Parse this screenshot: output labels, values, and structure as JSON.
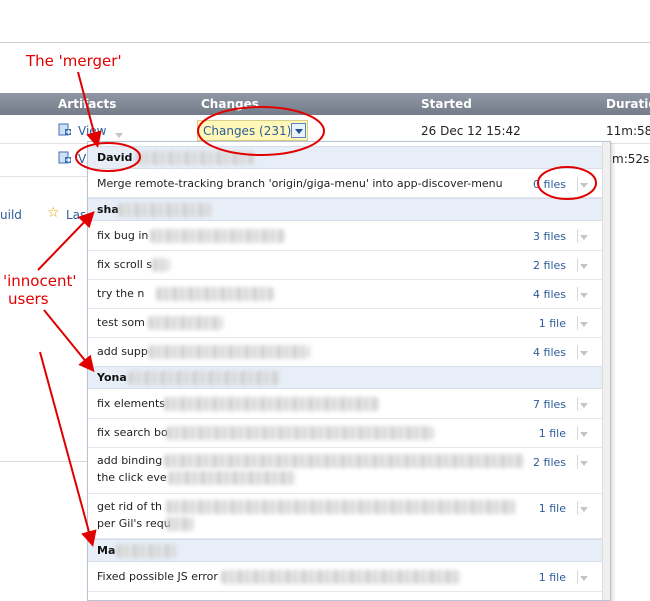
{
  "table": {
    "headers": {
      "artifacts": "Artifacts",
      "changes": "Changes",
      "started": "Started",
      "duration": "Duratio"
    },
    "row1": {
      "artifact": "View",
      "changes": "Changes (231)",
      "started": "26 Dec 12 15:42",
      "duration": "11m:58"
    },
    "row2": {
      "artifact": "V",
      "duration": "m:52s"
    }
  },
  "side": {
    "build": "uild",
    "last": "Las"
  },
  "popup": {
    "groups": [
      {
        "name": "David",
        "commits": [
          {
            "message": "Merge remote-tracking branch 'origin/giga-menu' into app-discover-menu",
            "files": "0 files"
          }
        ]
      },
      {
        "name": "sha",
        "commits": [
          {
            "message": "fix bug in",
            "files": "3 files"
          },
          {
            "message": "fix scroll s",
            "files": "2 files"
          },
          {
            "message": "try the n",
            "files": "4 files"
          },
          {
            "message": "test som",
            "files": "1 file"
          },
          {
            "message": "add supp",
            "files": "4 files"
          }
        ]
      },
      {
        "name": "Yona",
        "commits": [
          {
            "message": "fix elements",
            "files": "7 files"
          },
          {
            "message": "fix search bo",
            "files": "1 file"
          },
          {
            "message": "add binding",
            "message2": "the click eve",
            "files": "2 files"
          },
          {
            "message": "get rid of th",
            "message2": "per Gil's requ",
            "files": "1 file"
          }
        ]
      },
      {
        "name": "Ma",
        "commits": [
          {
            "message": "Fixed possible JS error",
            "files": "1 file"
          }
        ]
      }
    ]
  },
  "annotations": {
    "merger": "The 'merger'",
    "innocent_line1": "'innocent'",
    "innocent_line2": "users"
  },
  "colors": {
    "annotation": "#e10000",
    "header_bar": "#7f8894",
    "link": "#2e5c9a",
    "highlight": "#fff8b8",
    "group_bg": "#e7eef8"
  }
}
